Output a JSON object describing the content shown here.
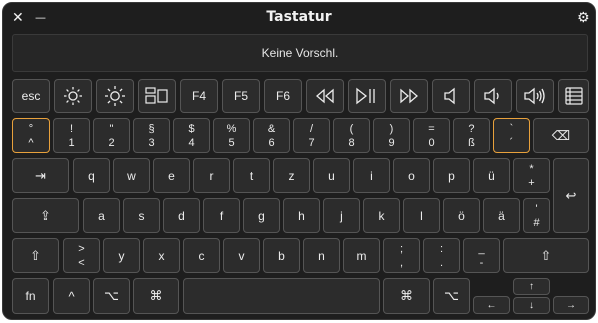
{
  "window": {
    "title": "Tastatur",
    "close_glyph": "✕",
    "minimize_glyph": "—",
    "settings_glyph": "⚙"
  },
  "suggestion": {
    "text": "Keine Vorschl."
  },
  "row_fn": {
    "esc": "esc",
    "f4": "F4",
    "f5": "F5",
    "f6": "F6",
    "icons": [
      "brightness-down-icon",
      "brightness-up-icon",
      "mission-control-icon",
      "rewind-icon",
      "play-pause-icon",
      "fast-forward-icon",
      "mute-icon",
      "volume-down-icon",
      "volume-up-icon",
      "list-icon"
    ]
  },
  "row_num": {
    "keys": [
      {
        "top": "°",
        "bottom": "^"
      },
      {
        "top": "!",
        "bottom": "1"
      },
      {
        "top": "\"",
        "bottom": "2"
      },
      {
        "top": "§",
        "bottom": "3"
      },
      {
        "top": "$",
        "bottom": "4"
      },
      {
        "top": "%",
        "bottom": "5"
      },
      {
        "top": "&",
        "bottom": "6"
      },
      {
        "top": "/",
        "bottom": "7"
      },
      {
        "top": "(",
        "bottom": "8"
      },
      {
        "top": ")",
        "bottom": "9"
      },
      {
        "top": "=",
        "bottom": "0"
      },
      {
        "top": "?",
        "bottom": "ß"
      },
      {
        "top": "`",
        "bottom": "´"
      }
    ],
    "delete_glyph": "⌫"
  },
  "row_q": {
    "tab_glyph": "⇥",
    "letters": [
      "q",
      "w",
      "e",
      "r",
      "t",
      "z",
      "u",
      "i",
      "o",
      "p",
      "ü"
    ],
    "plus": {
      "top": "*",
      "bottom": "+"
    },
    "return_glyph": "↩"
  },
  "row_a": {
    "caps_glyph": "⇪",
    "letters": [
      "a",
      "s",
      "d",
      "f",
      "g",
      "h",
      "j",
      "k",
      "l",
      "ö",
      "ä"
    ],
    "hash": {
      "top": "'",
      "bottom": "#"
    }
  },
  "row_y": {
    "shift_glyph": "⇧",
    "angle": {
      "top": ">",
      "bottom": "<"
    },
    "letters": [
      "y",
      "x",
      "c",
      "v",
      "b",
      "n",
      "m"
    ],
    "punct": [
      {
        "top": ";",
        "bottom": ","
      },
      {
        "top": ":",
        "bottom": "."
      },
      {
        "top": "_",
        "bottom": "-"
      }
    ]
  },
  "row_bottom": {
    "fn": "fn",
    "ctrl": "^",
    "opt": "⌥",
    "cmd": "⌘",
    "arrows": {
      "up": "↑",
      "down": "↓",
      "left": "←",
      "right": "→"
    }
  }
}
